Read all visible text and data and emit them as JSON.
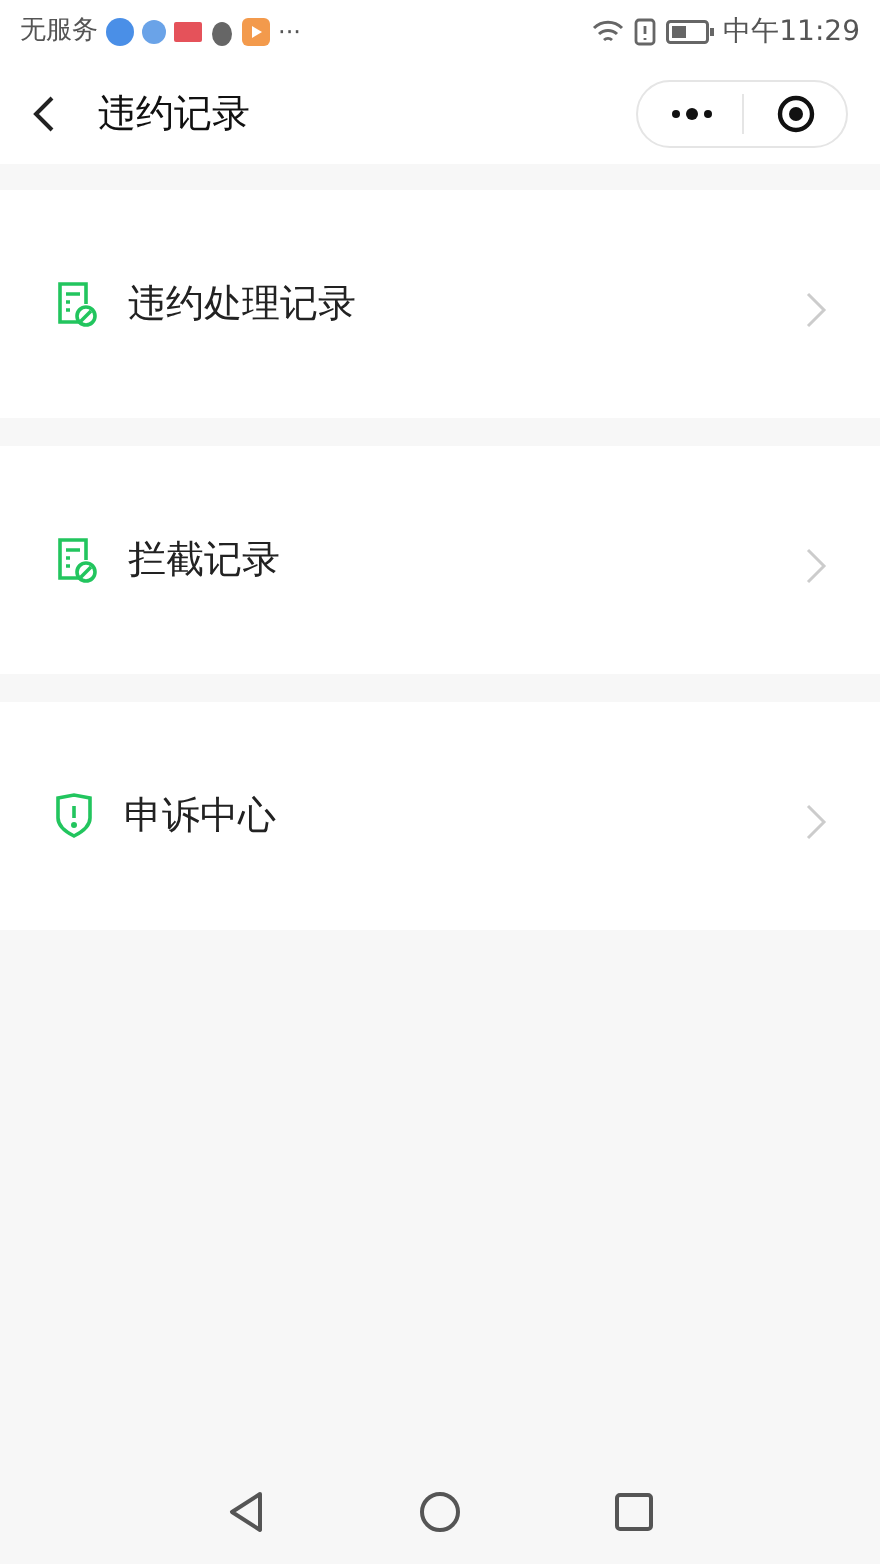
{
  "status_bar": {
    "carrier": "无服务",
    "more": "···",
    "time": "中午11:29"
  },
  "nav": {
    "title": "违约记录"
  },
  "items": [
    {
      "kind": "record",
      "label": "违约处理记录"
    },
    {
      "kind": "record",
      "label": "拦截记录"
    },
    {
      "kind": "shield",
      "label": "申诉中心"
    }
  ]
}
